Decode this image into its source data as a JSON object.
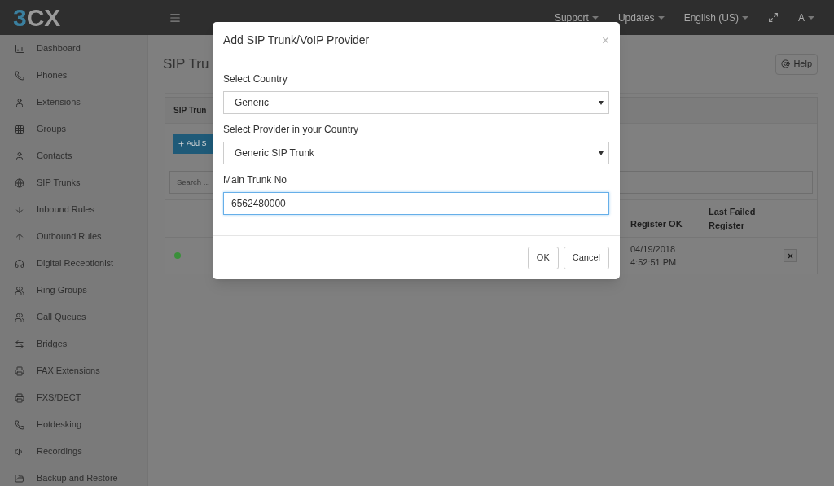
{
  "topbar": {
    "logo": {
      "digit": "3",
      "letters": "CX"
    },
    "menus": [
      {
        "label": "Support",
        "kind": "dropdown"
      },
      {
        "label": "Updates",
        "kind": "dropdown"
      },
      {
        "label": "English (US)",
        "kind": "dropdown"
      },
      {
        "kind": "fullscreen"
      },
      {
        "label": "A",
        "kind": "dropdown"
      }
    ]
  },
  "sidebar": {
    "items": [
      {
        "label": "Dashboard",
        "kind": "chart"
      },
      {
        "label": "Phones",
        "kind": "phone"
      },
      {
        "label": "Extensions",
        "kind": "user"
      },
      {
        "label": "Groups",
        "kind": "grid"
      },
      {
        "label": "Contacts",
        "kind": "user"
      },
      {
        "label": "SIP Trunks",
        "kind": "globe"
      },
      {
        "label": "Inbound Rules",
        "kind": "down"
      },
      {
        "label": "Outbound Rules",
        "kind": "up"
      },
      {
        "label": "Digital Receptionist",
        "kind": "headset"
      },
      {
        "label": "Ring Groups",
        "kind": "users"
      },
      {
        "label": "Call Queues",
        "kind": "users"
      },
      {
        "label": "Bridges",
        "kind": "swap"
      },
      {
        "label": "FAX Extensions",
        "kind": "fax"
      },
      {
        "label": "FXS/DECT",
        "kind": "fax"
      },
      {
        "label": "Hotdesking",
        "kind": "phone"
      },
      {
        "label": "Recordings",
        "kind": "speaker"
      },
      {
        "label": "Backup and Restore",
        "kind": "folder"
      }
    ]
  },
  "page": {
    "title": "SIP Tru",
    "help_button": "Help",
    "panel": {
      "heading": "SIP Trun",
      "add_button": "Add S",
      "search": {
        "placeholder": "Search ..."
      },
      "table": {
        "columns": [
          "Register OK",
          "Last Failed Register"
        ],
        "rows": [
          {
            "color": "#3a8f3a",
            "register_ok": "04/19/2018 4:52:51 PM"
          }
        ]
      }
    }
  },
  "dialog": {
    "title": "Add SIP Trunk/VoIP Provider",
    "close": "×",
    "fields": [
      {
        "label": "Select Country",
        "kind": "select",
        "value": "Generic",
        "focused": false
      },
      {
        "label": "Select Provider in your Country",
        "kind": "select",
        "value": "Generic SIP Trunk",
        "focused": false
      },
      {
        "label": "Main Trunk No",
        "kind": "input",
        "value": "6562480000",
        "focused": true
      }
    ],
    "buttons": [
      {
        "label": "OK"
      },
      {
        "label": "Cancel"
      }
    ]
  }
}
